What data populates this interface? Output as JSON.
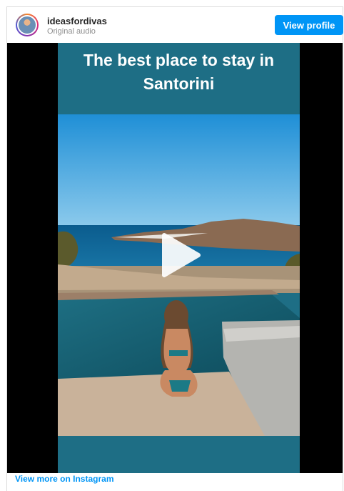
{
  "post": {
    "username": "ideasfordivas",
    "audio_label": "Original audio",
    "view_profile_label": "View profile"
  },
  "reel": {
    "title_line1": "The best place to stay in",
    "title_line2": "Santorini"
  },
  "footer": {
    "more_link": "View more on Instagram"
  },
  "colors": {
    "accent": "#0095f6",
    "reel_band": "#1e6e85"
  },
  "icons": [
    "play-icon"
  ]
}
